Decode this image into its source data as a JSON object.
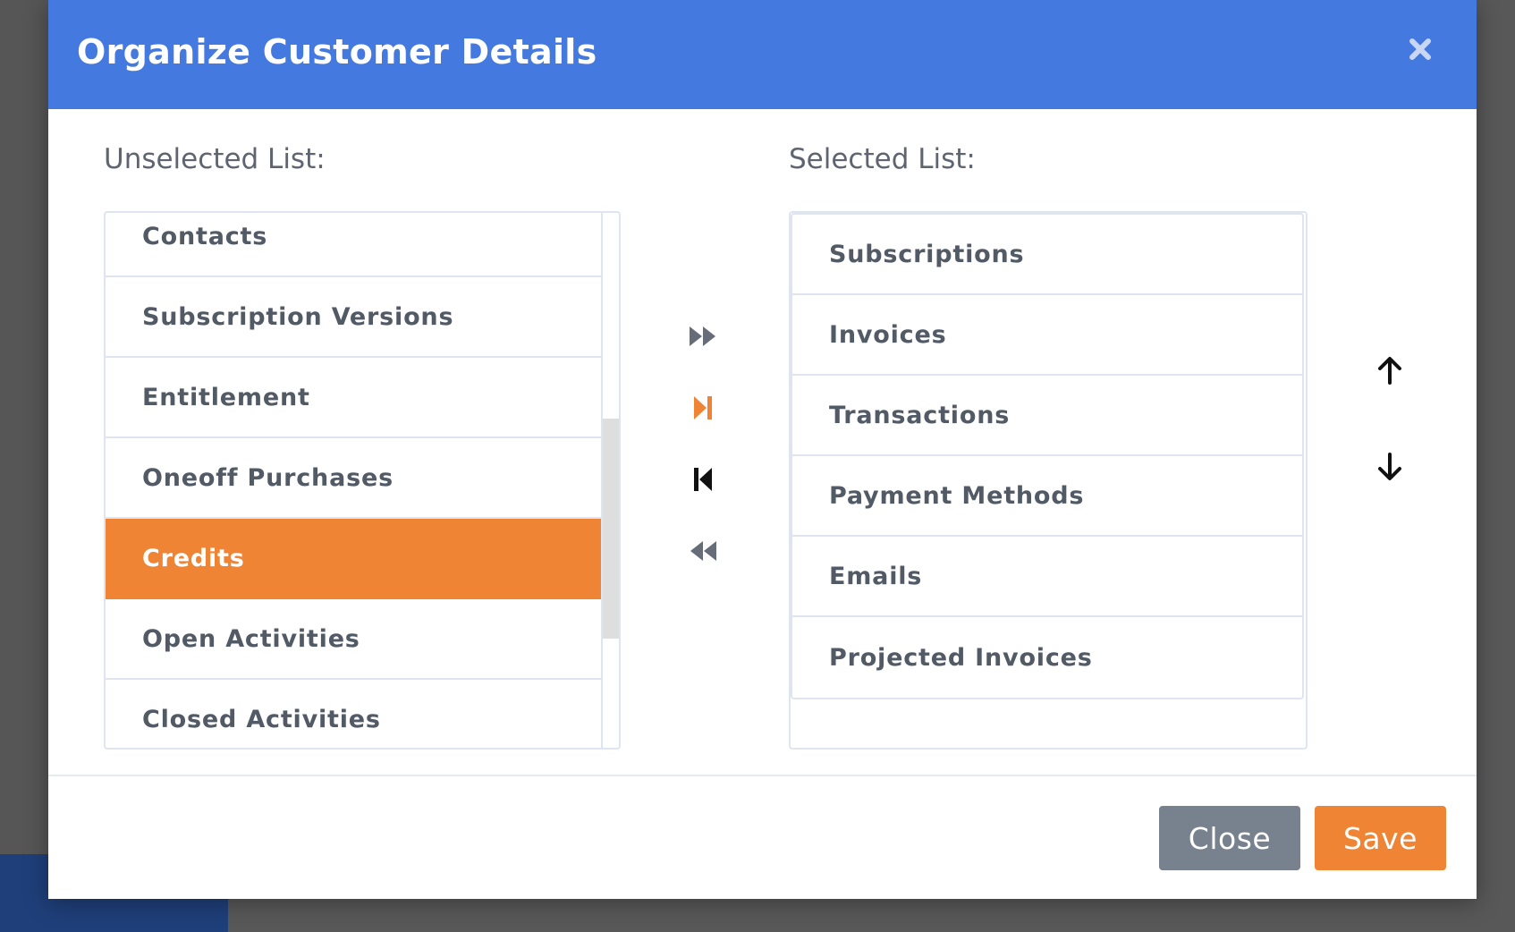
{
  "modal": {
    "title": "Organize Customer Details",
    "close_icon": "close-icon"
  },
  "unselected": {
    "label": "Unselected List:",
    "items": [
      {
        "label": "Contacts"
      },
      {
        "label": "Subscription Versions"
      },
      {
        "label": "Entitlement"
      },
      {
        "label": "Oneoff Purchases"
      },
      {
        "label": "Credits",
        "selected": true
      },
      {
        "label": "Open Activities"
      },
      {
        "label": "Closed Activities"
      }
    ]
  },
  "selected": {
    "label": "Selected List:",
    "items": [
      {
        "label": "Subscriptions"
      },
      {
        "label": "Invoices"
      },
      {
        "label": "Transactions"
      },
      {
        "label": "Payment Methods"
      },
      {
        "label": "Emails"
      },
      {
        "label": "Projected Invoices"
      }
    ]
  },
  "transfer_controls": [
    {
      "icon": "move-all-right-icon"
    },
    {
      "icon": "move-selected-right-icon"
    },
    {
      "icon": "move-selected-left-icon"
    },
    {
      "icon": "move-all-left-icon"
    }
  ],
  "order_controls": [
    {
      "icon": "arrow-up-icon"
    },
    {
      "icon": "arrow-down-icon"
    }
  ],
  "footer": {
    "close_label": "Close",
    "save_label": "Save"
  },
  "colors": {
    "header": "#4479df",
    "accent": "#ee8434",
    "close_button": "#78818e",
    "item_text": "#525a66",
    "border": "#dfe5ef"
  }
}
